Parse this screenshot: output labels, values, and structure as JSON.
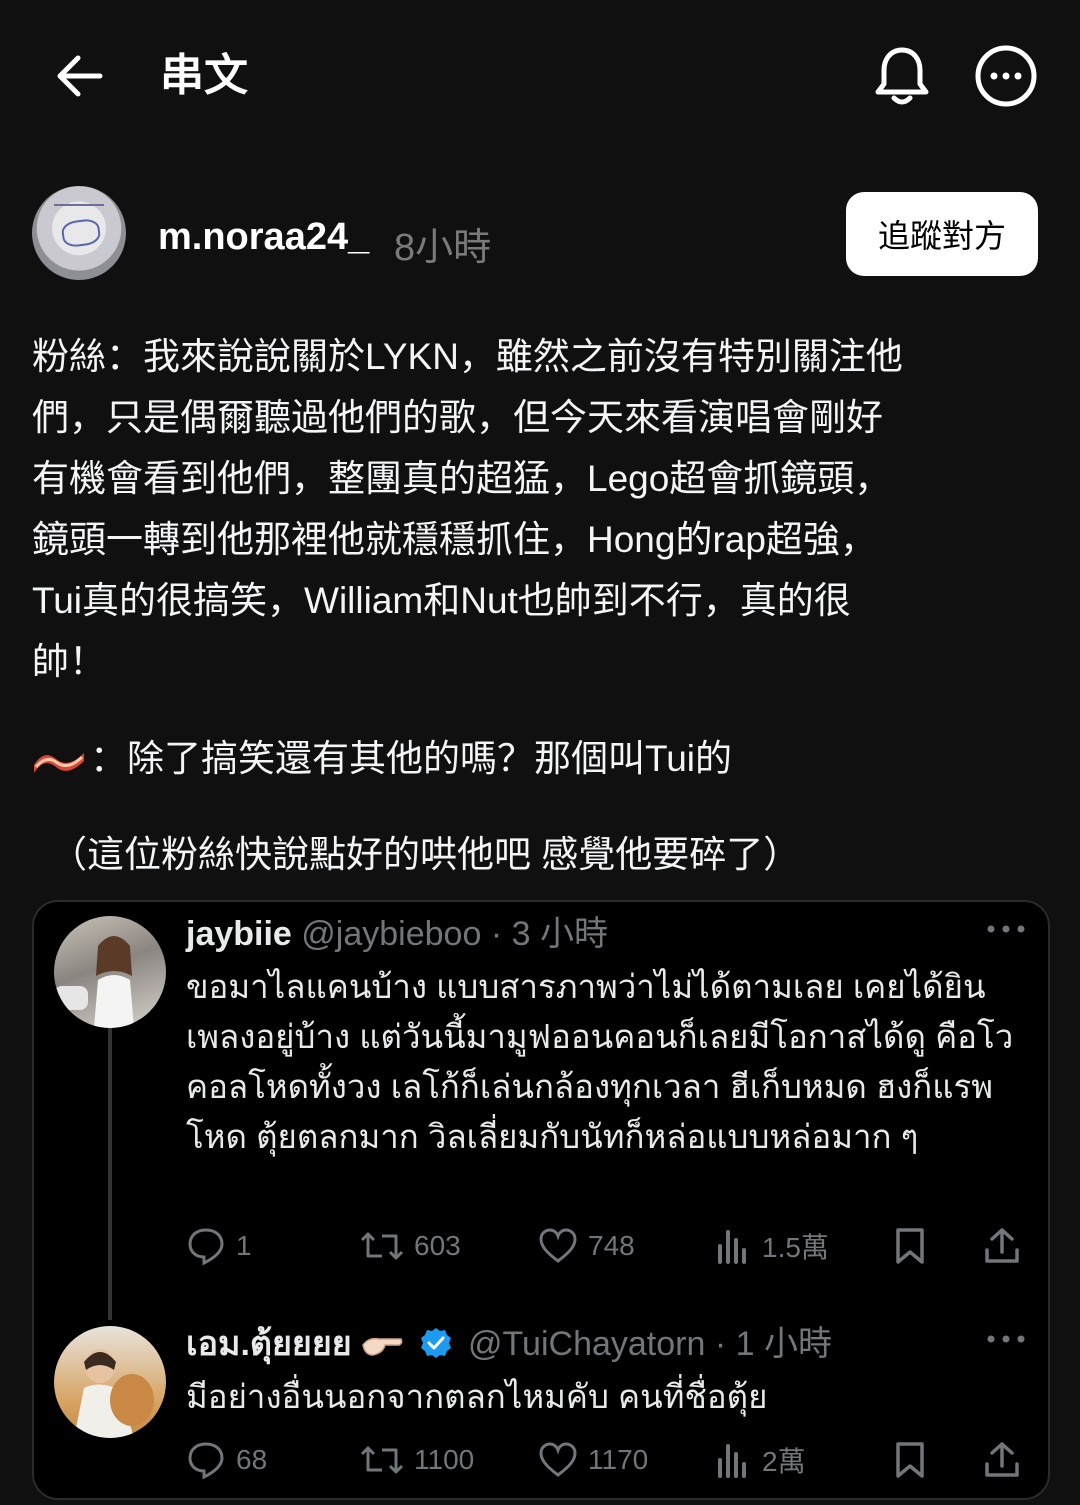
{
  "header": {
    "title": "串文"
  },
  "post": {
    "username": "m.noraa24_",
    "time": "8小時",
    "follow_label": "追蹤對方",
    "body": "粉絲：我來說說關於LYKN，雖然之前沒有特別關注他\n們，只是偶爾聽過他們的歌，但今天來看演唱會剛好\n有機會看到他們，整團真的超猛，Lego超會抓鏡頭，\n鏡頭一轉到他那裡他就穩穩抓住，Hong的rap超強，\nTui真的很搞笑，William和Nut也帥到不行，真的很\n帥！",
    "reply_text": "：除了搞笑還有其他的嗎？那個叫Tui的",
    "note": "（這位粉絲快說點好的哄他吧 感覺他要碎了）"
  },
  "embedded_tweets": [
    {
      "name": "jaybiie",
      "handle": "@jaybieboo",
      "time": "· 3 小時",
      "text": "ขอมาไลแคนบ้าง แบบสารภาพว่าไม่ได้ตามเลย เคยได้ยินเพลงอยู่บ้าง แต่วันนี้มามูฟออนคอนก็เลยมีโอกาสได้ดู คือโวคอลโหดทั้งวง เลโก้ก็เล่นกล้องทุกเวลา ฮีเก็บหมด ฮงก็แรพโหด ตุ้ยตลกมาก วิลเลี่ยมกับนัทก็หล่อแบบหล่อมาก ๆ",
      "replies": "1",
      "retweets": "603",
      "likes": "748",
      "views": "1.5萬"
    },
    {
      "name": "เอม.ตุ้ยยยย",
      "handle": "@TuiChayatorn",
      "time": "· 1 小時",
      "text": "มีอย่างอื่นนอกจากตลกไหมคับ คนที่ชื่อตุ้ย",
      "replies": "68",
      "retweets": "1100",
      "likes": "1170",
      "views": "2萬"
    }
  ],
  "colors": {
    "background": "#101010",
    "muted": "#71767b",
    "verified": "#1d9bf0"
  }
}
